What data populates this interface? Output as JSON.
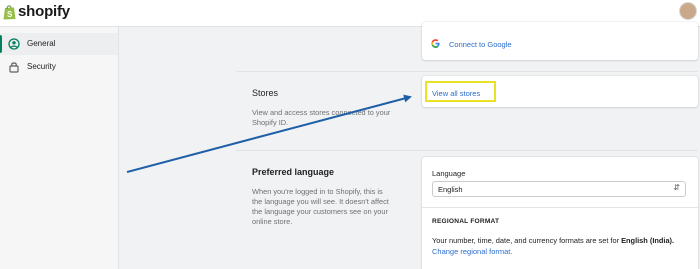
{
  "header": {
    "brand": "shopify"
  },
  "sidebar": {
    "items": [
      {
        "label": "General",
        "icon": "user-circle-icon",
        "active": true
      },
      {
        "label": "Security",
        "icon": "lock-icon",
        "active": false
      }
    ]
  },
  "connect": {
    "label": "Connect to Google",
    "icon": "google-icon"
  },
  "stores": {
    "title": "Stores",
    "description": "View and access stores connected to your Shopify ID.",
    "link": "View all stores",
    "highlight_color": "#e8e227"
  },
  "language": {
    "title": "Preferred language",
    "description": "When you're logged in to Shopify, this is the language you will see. It doesn't affect the language your customers see on your online store.",
    "field_label": "Language",
    "selected": "English",
    "regional_heading": "REGIONAL FORMAT",
    "regional_text": "Your number, time, date, and currency formats are set for ",
    "regional_value": "English (India).",
    "regional_link": "Change regional format."
  },
  "colors": {
    "accent": "#2c6ecb",
    "arrow": "#1f5fa8",
    "brand_green": "#95bf47"
  }
}
